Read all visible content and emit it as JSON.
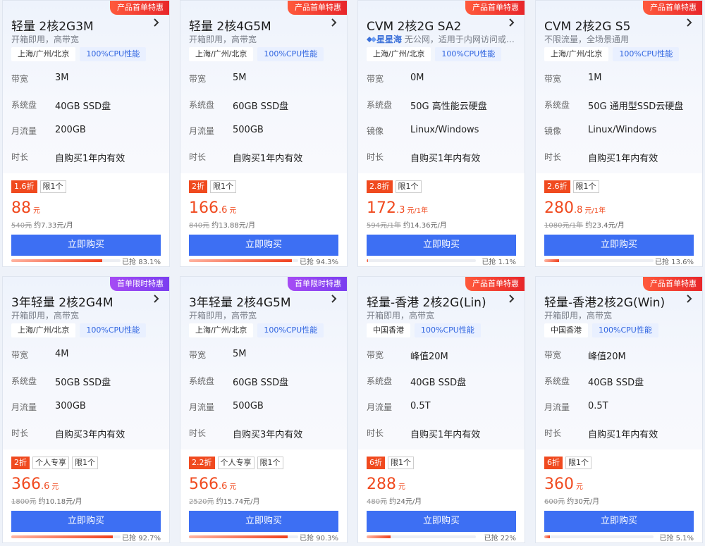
{
  "cards": [
    {
      "ribbon": "产品首单特惠",
      "ribbon_color": "red",
      "title": "轻量 2核2G3M",
      "subtitle": "开箱即用，高带宽",
      "brand": "",
      "location": "上海/广州/北京",
      "cpu_tag": "100%CPU性能",
      "specs": [
        {
          "label": "带宽",
          "value": "3M"
        },
        {
          "label": "系统盘",
          "value": "40GB SSD盘"
        },
        {
          "label": "月流量",
          "value": "200GB"
        },
        {
          "label": "时长",
          "value": "自购买1年内有效"
        }
      ],
      "discount": "1.6折",
      "badges": [
        "限1个"
      ],
      "price_int": "88",
      "price_dec": "",
      "price_unit": "元",
      "original": "540元",
      "per_month": "约7.33元/月",
      "buy_label": "立即购买",
      "sold_text": "已抢 83.1%",
      "sold_pct": 83.1
    },
    {
      "ribbon": "产品首单特惠",
      "ribbon_color": "red",
      "title": "轻量 2核4G5M",
      "subtitle": "开箱即用，高带宽",
      "brand": "",
      "location": "上海/广州/北京",
      "cpu_tag": "100%CPU性能",
      "specs": [
        {
          "label": "带宽",
          "value": "5M"
        },
        {
          "label": "系统盘",
          "value": "60GB SSD盘"
        },
        {
          "label": "月流量",
          "value": "500GB"
        },
        {
          "label": "时长",
          "value": "自购买1年内有效"
        }
      ],
      "discount": "2折",
      "badges": [
        "限1个"
      ],
      "price_int": "166",
      "price_dec": ".6",
      "price_unit": "元",
      "original": "840元",
      "per_month": "约13.88元/月",
      "buy_label": "立即购买",
      "sold_text": "已抢 94.3%",
      "sold_pct": 94.3
    },
    {
      "ribbon": "产品首单特惠",
      "ribbon_color": "red",
      "title": "CVM 2核2G SA2",
      "subtitle": "无公网，适用于内网访问或…",
      "brand": "星星海",
      "location": "上海/广州/北京",
      "cpu_tag": "100%CPU性能",
      "specs": [
        {
          "label": "带宽",
          "value": "0M"
        },
        {
          "label": "系统盘",
          "value": "50G 高性能云硬盘"
        },
        {
          "label": "镜像",
          "value": "Linux/Windows"
        },
        {
          "label": "时长",
          "value": "自购买1年内有效"
        }
      ],
      "discount": "2.8折",
      "badges": [
        "限1个"
      ],
      "price_int": "172",
      "price_dec": ".3",
      "price_unit": "元/1年",
      "original": "594元/1年",
      "per_month": "约14.36元/月",
      "buy_label": "立即购买",
      "sold_text": "已抢 1.1%",
      "sold_pct": 1.1
    },
    {
      "ribbon": "产品首单特惠",
      "ribbon_color": "red",
      "title": "CVM 2核2G S5",
      "subtitle": "不限流量，全场景通用",
      "brand": "",
      "location": "上海/广州/北京",
      "cpu_tag": "100%CPU性能",
      "specs": [
        {
          "label": "带宽",
          "value": "1M"
        },
        {
          "label": "系统盘",
          "value": "50G 通用型SSD云硬盘"
        },
        {
          "label": "镜像",
          "value": "Linux/Windows"
        },
        {
          "label": "时长",
          "value": "自购买1年内有效"
        }
      ],
      "discount": "2.6折",
      "badges": [
        "限1个"
      ],
      "price_int": "280",
      "price_dec": ".8",
      "price_unit": "元/1年",
      "original": "1080元/1年",
      "per_month": "约23.4元/月",
      "buy_label": "立即购买",
      "sold_text": "已抢 13.6%",
      "sold_pct": 13.6
    },
    {
      "ribbon": "首单限时特惠",
      "ribbon_color": "purple",
      "title": "3年轻量 2核2G4M",
      "subtitle": "开箱即用，高带宽",
      "brand": "",
      "location": "上海/广州/北京",
      "cpu_tag": "100%CPU性能",
      "specs": [
        {
          "label": "带宽",
          "value": "4M"
        },
        {
          "label": "系统盘",
          "value": "50GB SSD盘"
        },
        {
          "label": "月流量",
          "value": "300GB"
        },
        {
          "label": "时长",
          "value": "自购买3年内有效"
        }
      ],
      "discount": "2折",
      "badges": [
        "个人专享",
        "限1个"
      ],
      "price_int": "366",
      "price_dec": ".6",
      "price_unit": "元",
      "original": "1800元",
      "per_month": "约10.18元/月",
      "buy_label": "立即购买",
      "sold_text": "已抢 92.7%",
      "sold_pct": 92.7
    },
    {
      "ribbon": "首单限时特惠",
      "ribbon_color": "purple",
      "title": "3年轻量 2核4G5M",
      "subtitle": "开箱即用，高带宽",
      "brand": "",
      "location": "上海/广州/北京",
      "cpu_tag": "100%CPU性能",
      "specs": [
        {
          "label": "带宽",
          "value": "5M"
        },
        {
          "label": "系统盘",
          "value": "60GB SSD盘"
        },
        {
          "label": "月流量",
          "value": "500GB"
        },
        {
          "label": "时长",
          "value": "自购买3年内有效"
        }
      ],
      "discount": "2.2折",
      "badges": [
        "个人专享",
        "限1个"
      ],
      "price_int": "566",
      "price_dec": ".6",
      "price_unit": "元",
      "original": "2520元",
      "per_month": "约15.74元/月",
      "buy_label": "立即购买",
      "sold_text": "已抢 90.3%",
      "sold_pct": 90.3
    },
    {
      "ribbon": "产品首单特惠",
      "ribbon_color": "red",
      "title": "轻量-香港 2核2G(Lin)",
      "subtitle": "开箱即用，高带宽",
      "brand": "",
      "location": "中国香港",
      "cpu_tag": "100%CPU性能",
      "specs": [
        {
          "label": "带宽",
          "value": "峰值20M"
        },
        {
          "label": "系统盘",
          "value": "40GB SSD盘"
        },
        {
          "label": "月流量",
          "value": "0.5T"
        },
        {
          "label": "时长",
          "value": "自购买1年内有效"
        }
      ],
      "discount": "6折",
      "badges": [
        "限1个"
      ],
      "price_int": "288",
      "price_dec": "",
      "price_unit": "元",
      "original": "480元",
      "per_month": "约24元/月",
      "buy_label": "立即购买",
      "sold_text": "已抢 22%",
      "sold_pct": 22
    },
    {
      "ribbon": "产品首单特惠",
      "ribbon_color": "red",
      "title": "轻量-香港2核2G(Win)",
      "subtitle": "开箱即用，高带宽",
      "brand": "",
      "location": "中国香港",
      "cpu_tag": "100%CPU性能",
      "specs": [
        {
          "label": "带宽",
          "value": "峰值20M"
        },
        {
          "label": "系统盘",
          "value": "40GB SSD盘"
        },
        {
          "label": "月流量",
          "value": "0.5T"
        },
        {
          "label": "时长",
          "value": "自购买1年内有效"
        }
      ],
      "discount": "6折",
      "badges": [
        "限1个"
      ],
      "price_int": "360",
      "price_dec": "",
      "price_unit": "元",
      "original": "600元",
      "per_month": "约30元/月",
      "buy_label": "立即购买",
      "sold_text": "已抢 5.1%",
      "sold_pct": 5.1
    }
  ]
}
